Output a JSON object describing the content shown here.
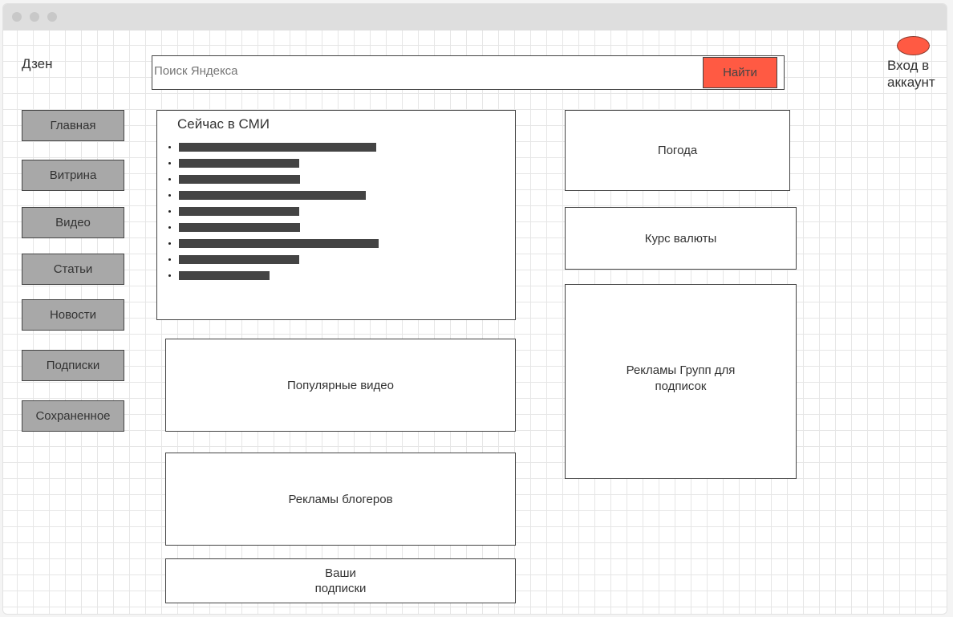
{
  "header": {
    "logo": "Дзен",
    "search_placeholder": "Поиск Яндекса",
    "search_button": "Найти",
    "login": "Вход в аккаунт"
  },
  "sidebar": {
    "items": [
      {
        "label": "Главная"
      },
      {
        "label": "Витрина"
      },
      {
        "label": "Видео"
      },
      {
        "label": "Статьи"
      },
      {
        "label": "Новости"
      },
      {
        "label": "Подписки"
      },
      {
        "label": "Сохраненное"
      }
    ]
  },
  "news": {
    "title": "Сейчас в СМИ",
    "item_count": 9
  },
  "blocks": {
    "popular_video": "Популярные видео",
    "blogger_ads": "Рекламы блогеров",
    "your_subscriptions": "Ваши подписки",
    "weather": "Погода",
    "currency": "Курс валюты",
    "group_ads": "Рекламы Групп для подписок"
  },
  "colors": {
    "accent": "#ff5a43",
    "nav_bg": "#a8a8a8"
  }
}
